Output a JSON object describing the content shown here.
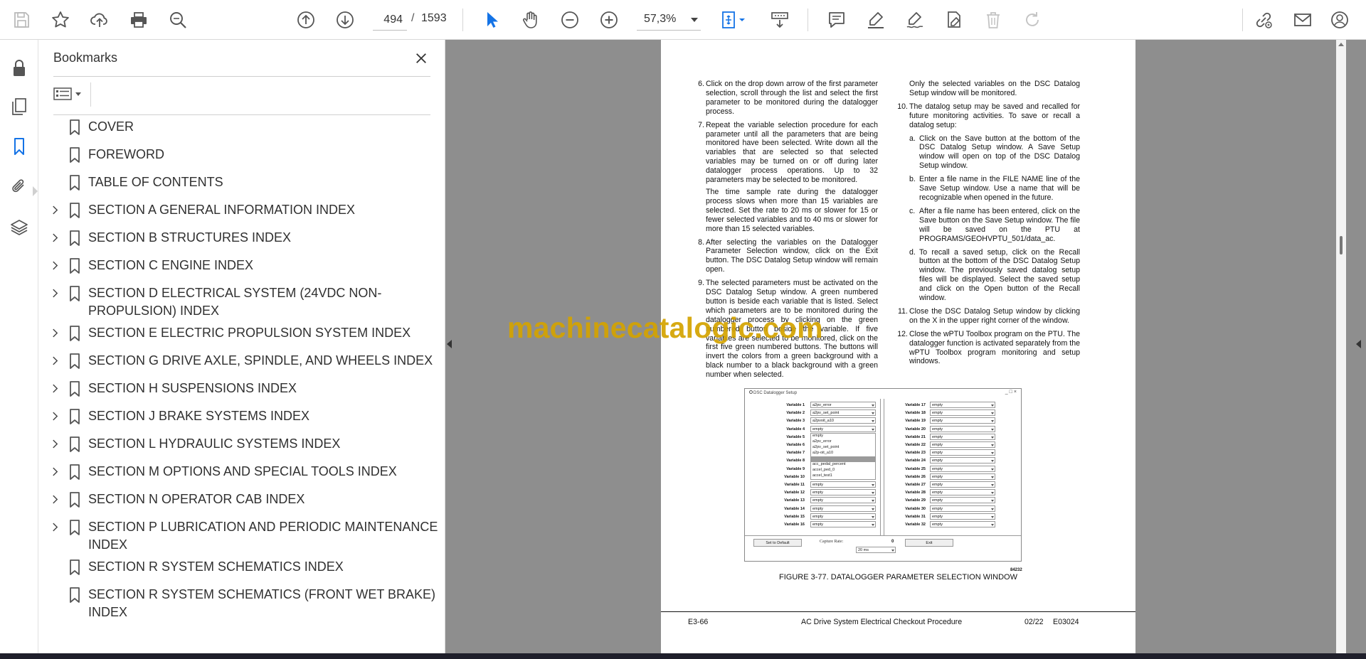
{
  "toolbar": {
    "page_current": "494",
    "page_separator": "/",
    "page_total": "1593",
    "zoom": "57,3%",
    "icons": [
      "save-icon",
      "star-icon",
      "upload-icon",
      "print-icon",
      "zoom-search-icon",
      "page-up-icon",
      "page-down-icon",
      "select-cursor-icon",
      "hand-icon",
      "zoom-out-icon",
      "zoom-in-icon",
      "fit-page-icon",
      "scroll-mode-icon",
      "comment-icon",
      "highlight-icon",
      "sign-icon",
      "fill-sign-icon",
      "delete-icon",
      "redo-icon",
      "share-link-icon",
      "email-icon",
      "account-icon"
    ]
  },
  "rail": {
    "icons": [
      "lock-icon",
      "pages-icon",
      "bookmark-icon",
      "attachment-icon",
      "layers-icon"
    ]
  },
  "bookmarks_panel": {
    "title": "Bookmarks",
    "items": [
      {
        "label": "COVER",
        "expandable": false
      },
      {
        "label": "FOREWORD",
        "expandable": false
      },
      {
        "label": "TABLE OF CONTENTS",
        "expandable": false
      },
      {
        "label": "SECTION A GENERAL INFORMATION INDEX",
        "expandable": true
      },
      {
        "label": "SECTION B STRUCTURES INDEX",
        "expandable": true
      },
      {
        "label": "SECTION C ENGINE INDEX",
        "expandable": true
      },
      {
        "label": "SECTION D ELECTRICAL SYSTEM (24VDC NON-PROPULSION) INDEX",
        "expandable": true
      },
      {
        "label": "SECTION E ELECTRIC PROPULSION SYSTEM INDEX",
        "expandable": true
      },
      {
        "label": "SECTION G DRIVE AXLE, SPINDLE, AND WHEELS INDEX",
        "expandable": true
      },
      {
        "label": "SECTION H SUSPENSIONS INDEX",
        "expandable": true
      },
      {
        "label": "SECTION J BRAKE SYSTEMS INDEX",
        "expandable": true
      },
      {
        "label": "SECTION L HYDRAULIC SYSTEMS INDEX",
        "expandable": true
      },
      {
        "label": "SECTION M OPTIONS AND SPECIAL TOOLS INDEX",
        "expandable": true
      },
      {
        "label": "SECTION N OPERATOR CAB INDEX",
        "expandable": true
      },
      {
        "label": "SECTION P LUBRICATION AND PERIODIC MAINTENANCE INDEX",
        "expandable": true
      },
      {
        "label": "SECTION R SYSTEM SCHEMATICS INDEX",
        "expandable": false
      },
      {
        "label": "SECTION R SYSTEM SCHEMATICS (FRONT WET BRAKE) INDEX",
        "expandable": false
      }
    ]
  },
  "document": {
    "left_column": {
      "step6_num": "6.",
      "step6": "Click on the drop down arrow of the first parameter selection, scroll through the list and select the first parameter to be monitored during the datalogger process.",
      "step7_num": "7.",
      "step7": "Repeat the variable selection procedure for each parameter until all the parameters that are being monitored have been selected. Write down all the variables that are selected so that selected variables may be turned on or off during later datalogger process operations. Up to 32 parameters may be selected to be monitored.",
      "step7_note": "The time sample rate during the datalogger process slows when more than 15 variables are selected. Set the rate to 20 ms or slower for 15 or fewer selected variables and to 40 ms or slower for more than 15 selected variables.",
      "step8_num": "8.",
      "step8": "After selecting the variables on the Datalogger Parameter Selection window, click on the Exit button. The DSC Datalog Setup window will remain open.",
      "step9_num": "9.",
      "step9": "The selected parameters must be activated on the DSC Datalog Setup window. A green numbered button is beside each variable that is listed. Select which parameters are to be monitored during the datalogger process by clicking on the green numbered button beside the variable. If five variables are selected to be monitored, click on the first five green numbered buttons. The buttons will invert the colors from a green background with a black number to a black background with a green number when selected."
    },
    "right_column": {
      "step9_cont": "Only the selected variables on the DSC Datalog Setup window will be monitored.",
      "step10_num": "10.",
      "step10": "The datalog setup may be saved and recalled for future monitoring activities. To save or recall a datalog setup:",
      "a_num": "a.",
      "a": "Click on the Save button at the bottom of the DSC Datalog Setup window. A Save Setup window will open on top of the DSC Datalog Setup window.",
      "b_num": "b.",
      "b": "Enter a file name in the FILE NAME line of the Save Setup window. Use a name that will be recognizable when opened in the future.",
      "c_num": "c.",
      "c": "After a file name has been entered, click on the Save button on the Save Setup window. The file will be saved on the PTU at PROGRAMS/GEOHVPTU_501/data_ac.",
      "d_num": "d.",
      "d": "To recall a saved setup, click on the Recall button at the bottom of the DSC Datalog Setup window. The previously saved datalog setup files will be displayed. Select the saved setup and click on the Open button of the Recall window.",
      "step11_num": "11.",
      "step11": "Close the DSC Datalog Setup window by clicking on the X in the upper right corner of the window.",
      "step12_num": "12.",
      "step12": "Close the wPTU Toolbox program on the PTU. The datalogger function is activated separately from the wPTU Toolbox program monitoring and setup windows."
    },
    "watermark": "machinecatalogic.com",
    "figure": {
      "window_title": "DSC Datalogger Setup",
      "window_buttons": "_□×",
      "left_vars": [
        {
          "label": "Variable 1",
          "value": "a2pv_error"
        },
        {
          "label": "Variable 2",
          "value": "a2pv_set_point"
        },
        {
          "label": "Variable 3",
          "value": "a2pvoit_a10"
        },
        {
          "label": "Variable 4",
          "value": "empty"
        },
        {
          "label": "Variable 5",
          "value": ""
        },
        {
          "label": "Variable 6",
          "value": ""
        },
        {
          "label": "Variable 7",
          "value": ""
        },
        {
          "label": "Variable 8",
          "value": ""
        },
        {
          "label": "Variable 9",
          "value": ""
        },
        {
          "label": "Variable 10",
          "value": ""
        },
        {
          "label": "Variable 11",
          "value": "empty"
        },
        {
          "label": "Variable 12",
          "value": "empty"
        },
        {
          "label": "Variable 13",
          "value": "empty"
        },
        {
          "label": "Variable 14",
          "value": "empty"
        },
        {
          "label": "Variable 15",
          "value": "empty"
        },
        {
          "label": "Variable 16",
          "value": "empty"
        }
      ],
      "dropdown_options": [
        "empty",
        "a2pv_error",
        "a2pv_set_point",
        "a2p-oit_a10",
        "",
        "acc_pedal_percent",
        "accel_ped_0",
        "accel_test1"
      ],
      "right_vars": [
        {
          "label": "Variable 17",
          "value": "empty"
        },
        {
          "label": "Variable 18",
          "value": "empty"
        },
        {
          "label": "Variable 19",
          "value": "empty"
        },
        {
          "label": "Variable 20",
          "value": "empty"
        },
        {
          "label": "Variable 21",
          "value": "empty"
        },
        {
          "label": "Variable 22",
          "value": "empty"
        },
        {
          "label": "Variable 23",
          "value": "empty"
        },
        {
          "label": "Variable 24",
          "value": "empty"
        },
        {
          "label": "Variable 25",
          "value": "empty"
        },
        {
          "label": "Variable 26",
          "value": "empty"
        },
        {
          "label": "Variable 27",
          "value": "empty"
        },
        {
          "label": "Variable 28",
          "value": "empty"
        },
        {
          "label": "Variable 29",
          "value": "empty"
        },
        {
          "label": "Variable 30",
          "value": "empty"
        },
        {
          "label": "Variable 31",
          "value": "empty"
        },
        {
          "label": "Variable 32",
          "value": "empty"
        }
      ],
      "set_default": "Set to Default",
      "capture_rate_label": "Capture Rate:",
      "capture_rate_value": "0",
      "capture_rate_select": "20 ms",
      "exit": "Exit",
      "figure_number": "84232",
      "caption": "FIGURE 3-77. DATALOGGER PARAMETER SELECTION WINDOW"
    },
    "footer": {
      "page": "E3-66",
      "title": "AC Drive System Electrical Checkout Procedure",
      "date": "02/22",
      "doc": "E03024"
    }
  },
  "colors": {
    "accent_blue": "#1473e6",
    "watermark": "#d4a300",
    "doc_background": "#8e8e8e",
    "taskbar": "#1f1f2b"
  }
}
